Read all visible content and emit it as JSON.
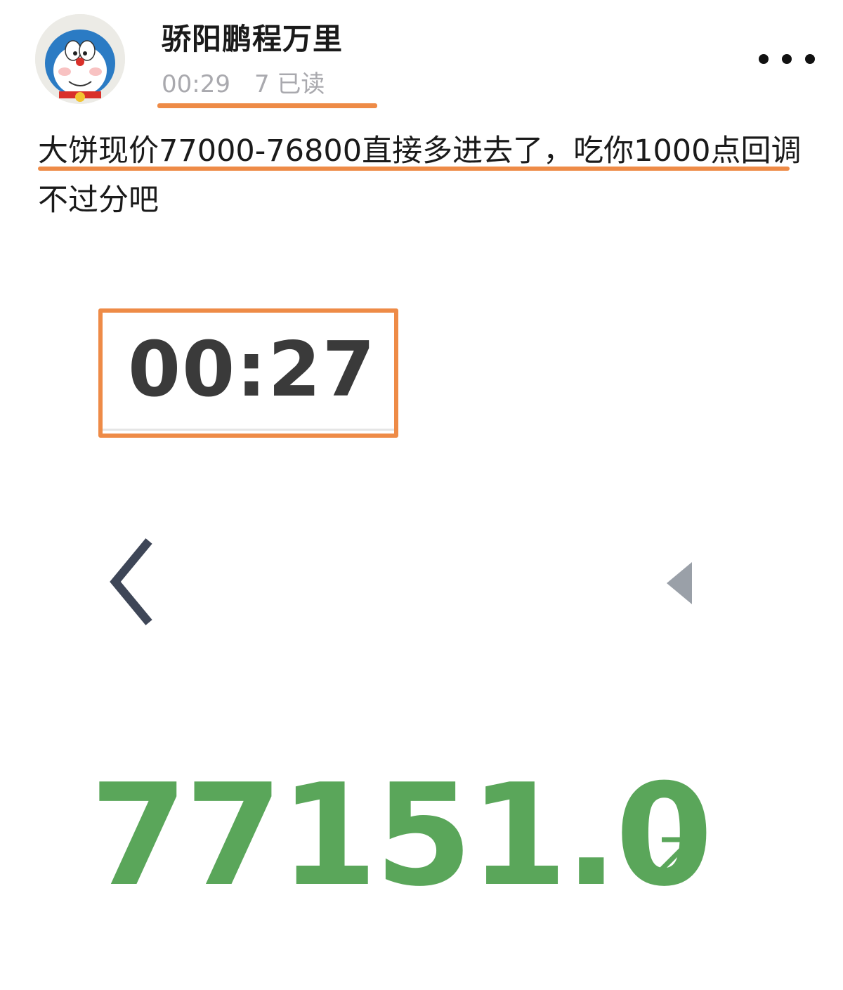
{
  "post": {
    "author": "骄阳鹏程万里",
    "time": "00:29",
    "read_count": "7 已读",
    "text": "大饼现价77000-76800直接多进去了，吃你1000点回调不过分吧",
    "avatar_icon": "doraemon-avatar",
    "more_icon": "more-dots-icon"
  },
  "screenshot": {
    "clock": "00:27",
    "back_icon": "chevron-left-icon",
    "play_icon": "triangle-left-icon",
    "price": "77151.0",
    "trend_icon": "arrow-up-right-icon",
    "price_color": "#5aa65a"
  },
  "colors": {
    "highlight": "#ee8b47",
    "meta_text": "#a9a9ae"
  }
}
